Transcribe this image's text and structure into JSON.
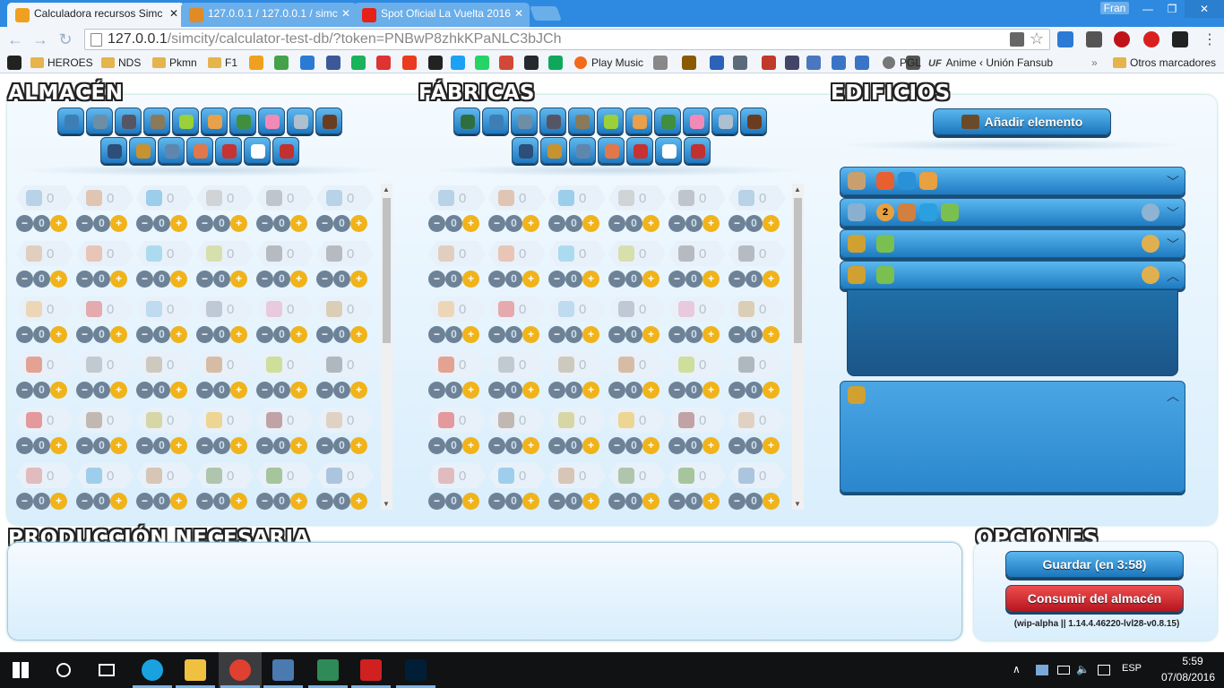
{
  "browser": {
    "tabs": [
      {
        "title": "Calculadora recursos Simc",
        "icon_color": "#f0a020",
        "active": true
      },
      {
        "title": "127.0.0.1 / 127.0.0.1 / simc",
        "icon_color": "#e28a24",
        "active": false
      },
      {
        "title": "Spot Oficial La Vuelta 2016",
        "icon_color": "#e62117",
        "active": false
      }
    ],
    "user": "Fran",
    "url_lead": "127.0.0.1",
    "url_rest": "/simcity/calculator-test-db/?token=PNBwP8zhkKPaNLC3bJCh",
    "bookmarks": [
      {
        "label": "",
        "kind": "icon",
        "color": "#222"
      },
      {
        "label": "HEROES",
        "kind": "folder"
      },
      {
        "label": "NDS",
        "kind": "folder"
      },
      {
        "label": "Pkmn",
        "kind": "folder"
      },
      {
        "label": "F1",
        "kind": "folder"
      },
      {
        "label": "Play Music",
        "kind": "icon",
        "color": "#f26a1b"
      },
      {
        "label": "PGL",
        "kind": "icon",
        "color": "#555"
      },
      {
        "label": "Anime ‹ Unión Fansub",
        "kind": "icon",
        "color": "#444"
      },
      {
        "label": "Otros marcadores",
        "kind": "folder"
      }
    ],
    "bookmark_icons": [
      "#f0a020",
      "#44a24a",
      "#2b7bd5",
      "#3b5998",
      "#1ab25b",
      "#d33",
      "#ea3a1f",
      "#222",
      "#1da1f2",
      "#25d366",
      "#d14836",
      "#24292e",
      "#0fa85a",
      "#888",
      "#8a5a00",
      "#2c62b8",
      "#5a6a7a",
      "#c0392b",
      "#446",
      "#4a77c0",
      "#3a74c6",
      "#3a74c6",
      "#555"
    ]
  },
  "almacen": {
    "title": "ALMACÉN",
    "filter_row1": [
      "#3d7fb5",
      "#6e8ea6",
      "#556",
      "#8a7a5a",
      "#9ad03a",
      "#e9a04b",
      "#3f8f3f",
      "#f28ab8",
      "#aebfcf",
      "#6b3c1f"
    ],
    "filter_row2": [
      "#2c4e78",
      "#c8922f",
      "#5f87ad",
      "#e0784c",
      "#c73232",
      "#ffffff",
      "#c23030"
    ]
  },
  "fabricas": {
    "title": "FÁBRICAS",
    "filter_row1": [
      "#2f6f3f",
      "#3d7fb5",
      "#6e8ea6",
      "#556",
      "#8a7a5a",
      "#9ad03a",
      "#e9a04b",
      "#3f8f3f",
      "#f28ab8",
      "#aebfcf",
      "#6b3c1f"
    ],
    "filter_row2": [
      "#2c4e78",
      "#c8922f",
      "#5f87ad",
      "#e0784c",
      "#c73232",
      "#ffffff",
      "#c23030"
    ]
  },
  "resources": [
    {
      "color": "#8fb8d8",
      "value": "0"
    },
    {
      "color": "#d8a07a",
      "value": "0"
    },
    {
      "color": "#5ab0e0",
      "value": "0"
    },
    {
      "color": "#bcbcbc",
      "value": "0"
    },
    {
      "color": "#9aa0a8",
      "value": "0"
    },
    {
      "color": "#8fb8d8",
      "value": "0"
    },
    {
      "color": "#d8b090",
      "value": "0"
    },
    {
      "color": "#e8a080",
      "value": "0"
    },
    {
      "color": "#7ac8e8",
      "value": "0"
    },
    {
      "color": "#c8d070",
      "value": "0"
    },
    {
      "color": "#8a8e94",
      "value": "0"
    },
    {
      "color": "#8a8e94",
      "value": "0"
    },
    {
      "color": "#f0c080",
      "value": "0"
    },
    {
      "color": "#e07070",
      "value": "0"
    },
    {
      "color": "#9ac8e8",
      "value": "0"
    },
    {
      "color": "#9aa8b8",
      "value": "0"
    },
    {
      "color": "#e8a8c8",
      "value": "0"
    },
    {
      "color": "#d0b080",
      "value": "0"
    },
    {
      "color": "#e06040",
      "value": "0"
    },
    {
      "color": "#a0a8b0",
      "value": "0"
    },
    {
      "color": "#b8a890",
      "value": "0"
    },
    {
      "color": "#c89060",
      "value": "0"
    },
    {
      "color": "#b8d050",
      "value": "0"
    },
    {
      "color": "#808890",
      "value": "0"
    },
    {
      "color": "#e05050",
      "value": "0"
    },
    {
      "color": "#a08878",
      "value": "0"
    },
    {
      "color": "#c8c060",
      "value": "0"
    },
    {
      "color": "#f0c040",
      "value": "0"
    },
    {
      "color": "#a06060",
      "value": "0"
    },
    {
      "color": "#d8b898",
      "value": "0"
    },
    {
      "color": "#d89090",
      "value": "0"
    },
    {
      "color": "#60b0e0",
      "value": "0"
    },
    {
      "color": "#c8a080",
      "value": "0"
    },
    {
      "color": "#80a070",
      "value": "0"
    },
    {
      "color": "#70a050",
      "value": "0"
    },
    {
      "color": "#7aa0c8",
      "value": "0"
    }
  ],
  "counter": {
    "minus": "−",
    "mid": "0",
    "plus": "+"
  },
  "edificios": {
    "title": "EDIFICIOS",
    "add_button": "Añadir elemento",
    "bars": [
      {
        "icon": "#c8a070",
        "chips": [
          "#e86030",
          "#2a90d8",
          "#e8a040"
        ],
        "badge": "",
        "chevron": "⌄",
        "expanded": false
      },
      {
        "icon": "#8ab0d0",
        "chips": [
          "#d08040",
          "#2aa0e0",
          "#7ac050"
        ],
        "badge": "2",
        "chevron": "⌄",
        "expanded": false
      },
      {
        "icon": "#d0a030",
        "chips": [
          "#7ac050"
        ],
        "badge": "",
        "chevron": "⌄",
        "expanded": false
      },
      {
        "icon": "#d0a030",
        "chips": [
          "#7ac050"
        ],
        "badge": "",
        "chevron": "⌃",
        "expanded": true
      },
      {
        "icon": "#d0a030",
        "chips": [],
        "badge": "",
        "chevron": "⌃",
        "expanded": true
      }
    ]
  },
  "produccion": {
    "title": "PRODUCCIÓN NECESARIA"
  },
  "opciones": {
    "title": "OPCIONES",
    "save": "Guardar (en 3:58)",
    "consume": "Consumir del almacén",
    "version": "(wip-alpha || 1.14.4.46220-lvl28-v0.8.15)"
  },
  "taskbar": {
    "lang": "ESP",
    "time": "5:59",
    "date": "07/08/2016",
    "apps": [
      "#1aa1e0",
      "#f0c040",
      "#e04030",
      "#4a7ab0",
      "#2e8b57",
      "#d02020",
      "#001e36"
    ]
  }
}
